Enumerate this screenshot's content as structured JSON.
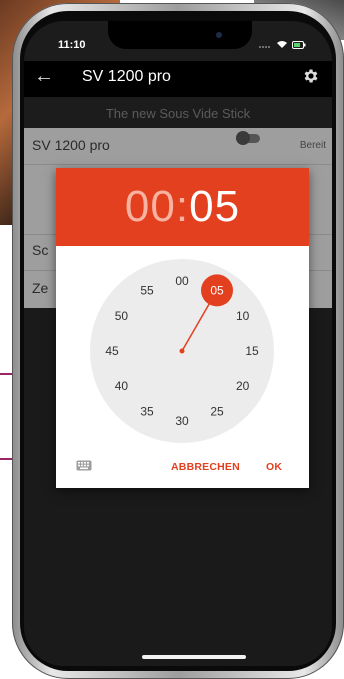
{
  "colors": {
    "accent": "#e2401f",
    "header_hours": "#f7b2a2",
    "dial_face": "#ececec",
    "guide_line": "#9b2466"
  },
  "status_bar": {
    "time": "11:10",
    "icons": [
      "signal-icon",
      "wifi-icon",
      "battery-icon"
    ]
  },
  "app_bar": {
    "back_icon": "arrow-left-icon",
    "title": "SV 1200 pro",
    "settings_icon": "gear-icon"
  },
  "sub_header": "The new Sous Vide Stick",
  "list": {
    "rows": [
      {
        "name": "SV 1200 pro",
        "status": "Bereit"
      },
      {
        "name": "Sc",
        "status": ""
      },
      {
        "name": "Ze",
        "status": ""
      }
    ]
  },
  "dialog": {
    "time": {
      "hours": "00",
      "separator": ":",
      "minutes": "05"
    },
    "dial_labels": [
      "00",
      "05",
      "10",
      "15",
      "20",
      "25",
      "30",
      "35",
      "40",
      "45",
      "50",
      "55"
    ],
    "selected_value": 5,
    "keyboard_icon": "keyboard-icon",
    "cancel_label": "ABBRECHEN",
    "ok_label": "OK"
  }
}
